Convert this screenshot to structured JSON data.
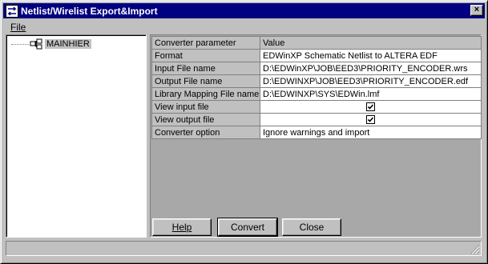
{
  "window": {
    "title": "Netlist/Wirelist Export&Import",
    "close_label": "×"
  },
  "menu": {
    "file_label": "File"
  },
  "tree": {
    "root_label": "MAINHIER"
  },
  "grid": {
    "headers": [
      "Converter parameter",
      "Value"
    ],
    "rows": [
      {
        "param": "Format",
        "value": "EDWinXP Schematic Netlist to ALTERA EDF",
        "checkbox": false
      },
      {
        "param": "Input File name",
        "value": "D:\\EDWinXP\\JOB\\EED3\\PRIORITY_ENCODER.wrs",
        "checkbox": false
      },
      {
        "param": "Output File name",
        "value": "D:\\EDWINXP\\JOB\\EED3\\PRIORITY_ENCODER.edf",
        "checkbox": false
      },
      {
        "param": "Library Mapping File name",
        "value": "D:\\EDWINXP\\SYS\\EDWin.lmf",
        "checkbox": false
      },
      {
        "param": "View input file",
        "value": "",
        "checkbox": true
      },
      {
        "param": "View output file",
        "value": "",
        "checkbox": true
      },
      {
        "param": "Converter option",
        "value": "Ignore warnings and import",
        "checkbox": false
      }
    ]
  },
  "buttons": {
    "help": "Help",
    "convert": "Convert",
    "close": "Close"
  },
  "colors": {
    "titlebar": "#000080",
    "face": "#c0c0c0",
    "workspace": "#a8a8a8"
  }
}
